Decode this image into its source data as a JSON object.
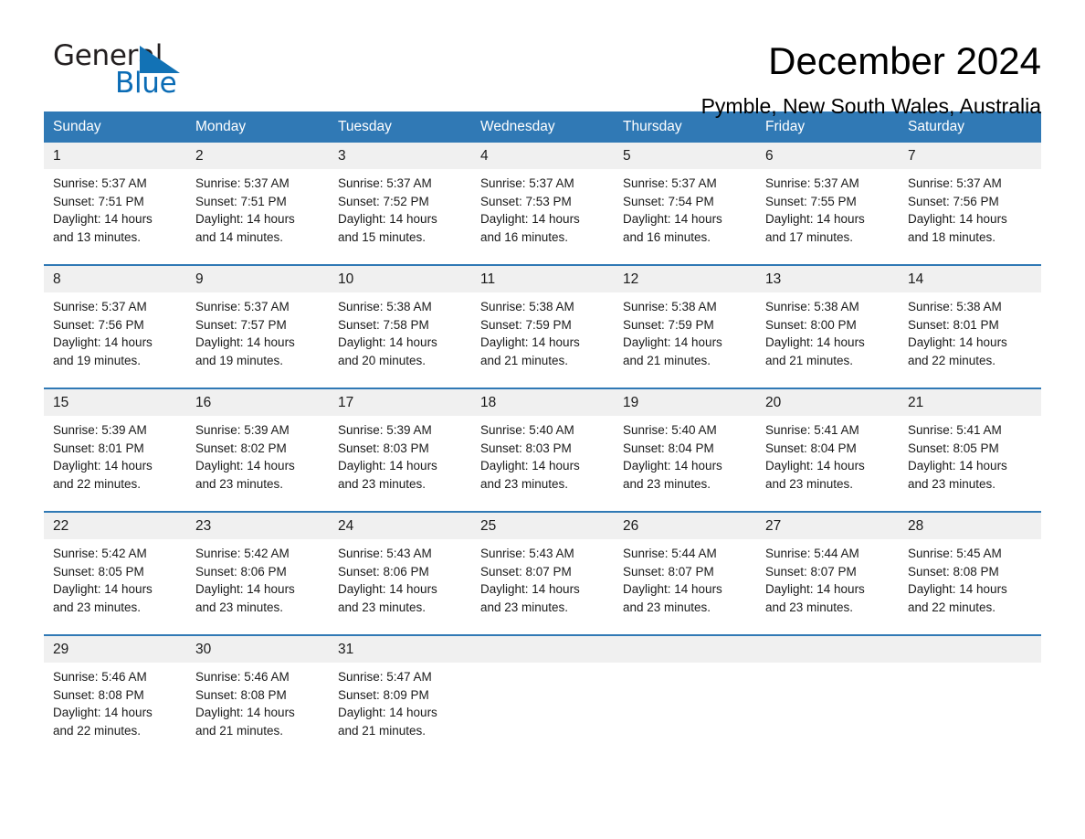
{
  "brand": {
    "name_part1": "General",
    "name_part2": "Blue",
    "triangle_icon": "brand-triangle-icon",
    "color_black": "#231f20",
    "color_blue": "#0b6cb5"
  },
  "header": {
    "title": "December 2024",
    "location": "Pymble, New South Wales, Australia"
  },
  "theme": {
    "header_blue": "#3079b5",
    "row_rule_blue": "#3079b5",
    "daynum_background": "#f0f0f0",
    "page_background": "#ffffff"
  },
  "calendar": {
    "weekday_headers": [
      "Sunday",
      "Monday",
      "Tuesday",
      "Wednesday",
      "Thursday",
      "Friday",
      "Saturday"
    ],
    "weeks": [
      [
        {
          "day": "1",
          "sunrise": "Sunrise: 5:37 AM",
          "sunset": "Sunset: 7:51 PM",
          "daylight_line1": "Daylight: 14 hours",
          "daylight_line2": "and 13 minutes."
        },
        {
          "day": "2",
          "sunrise": "Sunrise: 5:37 AM",
          "sunset": "Sunset: 7:51 PM",
          "daylight_line1": "Daylight: 14 hours",
          "daylight_line2": "and 14 minutes."
        },
        {
          "day": "3",
          "sunrise": "Sunrise: 5:37 AM",
          "sunset": "Sunset: 7:52 PM",
          "daylight_line1": "Daylight: 14 hours",
          "daylight_line2": "and 15 minutes."
        },
        {
          "day": "4",
          "sunrise": "Sunrise: 5:37 AM",
          "sunset": "Sunset: 7:53 PM",
          "daylight_line1": "Daylight: 14 hours",
          "daylight_line2": "and 16 minutes."
        },
        {
          "day": "5",
          "sunrise": "Sunrise: 5:37 AM",
          "sunset": "Sunset: 7:54 PM",
          "daylight_line1": "Daylight: 14 hours",
          "daylight_line2": "and 16 minutes."
        },
        {
          "day": "6",
          "sunrise": "Sunrise: 5:37 AM",
          "sunset": "Sunset: 7:55 PM",
          "daylight_line1": "Daylight: 14 hours",
          "daylight_line2": "and 17 minutes."
        },
        {
          "day": "7",
          "sunrise": "Sunrise: 5:37 AM",
          "sunset": "Sunset: 7:56 PM",
          "daylight_line1": "Daylight: 14 hours",
          "daylight_line2": "and 18 minutes."
        }
      ],
      [
        {
          "day": "8",
          "sunrise": "Sunrise: 5:37 AM",
          "sunset": "Sunset: 7:56 PM",
          "daylight_line1": "Daylight: 14 hours",
          "daylight_line2": "and 19 minutes."
        },
        {
          "day": "9",
          "sunrise": "Sunrise: 5:37 AM",
          "sunset": "Sunset: 7:57 PM",
          "daylight_line1": "Daylight: 14 hours",
          "daylight_line2": "and 19 minutes."
        },
        {
          "day": "10",
          "sunrise": "Sunrise: 5:38 AM",
          "sunset": "Sunset: 7:58 PM",
          "daylight_line1": "Daylight: 14 hours",
          "daylight_line2": "and 20 minutes."
        },
        {
          "day": "11",
          "sunrise": "Sunrise: 5:38 AM",
          "sunset": "Sunset: 7:59 PM",
          "daylight_line1": "Daylight: 14 hours",
          "daylight_line2": "and 21 minutes."
        },
        {
          "day": "12",
          "sunrise": "Sunrise: 5:38 AM",
          "sunset": "Sunset: 7:59 PM",
          "daylight_line1": "Daylight: 14 hours",
          "daylight_line2": "and 21 minutes."
        },
        {
          "day": "13",
          "sunrise": "Sunrise: 5:38 AM",
          "sunset": "Sunset: 8:00 PM",
          "daylight_line1": "Daylight: 14 hours",
          "daylight_line2": "and 21 minutes."
        },
        {
          "day": "14",
          "sunrise": "Sunrise: 5:38 AM",
          "sunset": "Sunset: 8:01 PM",
          "daylight_line1": "Daylight: 14 hours",
          "daylight_line2": "and 22 minutes."
        }
      ],
      [
        {
          "day": "15",
          "sunrise": "Sunrise: 5:39 AM",
          "sunset": "Sunset: 8:01 PM",
          "daylight_line1": "Daylight: 14 hours",
          "daylight_line2": "and 22 minutes."
        },
        {
          "day": "16",
          "sunrise": "Sunrise: 5:39 AM",
          "sunset": "Sunset: 8:02 PM",
          "daylight_line1": "Daylight: 14 hours",
          "daylight_line2": "and 23 minutes."
        },
        {
          "day": "17",
          "sunrise": "Sunrise: 5:39 AM",
          "sunset": "Sunset: 8:03 PM",
          "daylight_line1": "Daylight: 14 hours",
          "daylight_line2": "and 23 minutes."
        },
        {
          "day": "18",
          "sunrise": "Sunrise: 5:40 AM",
          "sunset": "Sunset: 8:03 PM",
          "daylight_line1": "Daylight: 14 hours",
          "daylight_line2": "and 23 minutes."
        },
        {
          "day": "19",
          "sunrise": "Sunrise: 5:40 AM",
          "sunset": "Sunset: 8:04 PM",
          "daylight_line1": "Daylight: 14 hours",
          "daylight_line2": "and 23 minutes."
        },
        {
          "day": "20",
          "sunrise": "Sunrise: 5:41 AM",
          "sunset": "Sunset: 8:04 PM",
          "daylight_line1": "Daylight: 14 hours",
          "daylight_line2": "and 23 minutes."
        },
        {
          "day": "21",
          "sunrise": "Sunrise: 5:41 AM",
          "sunset": "Sunset: 8:05 PM",
          "daylight_line1": "Daylight: 14 hours",
          "daylight_line2": "and 23 minutes."
        }
      ],
      [
        {
          "day": "22",
          "sunrise": "Sunrise: 5:42 AM",
          "sunset": "Sunset: 8:05 PM",
          "daylight_line1": "Daylight: 14 hours",
          "daylight_line2": "and 23 minutes."
        },
        {
          "day": "23",
          "sunrise": "Sunrise: 5:42 AM",
          "sunset": "Sunset: 8:06 PM",
          "daylight_line1": "Daylight: 14 hours",
          "daylight_line2": "and 23 minutes."
        },
        {
          "day": "24",
          "sunrise": "Sunrise: 5:43 AM",
          "sunset": "Sunset: 8:06 PM",
          "daylight_line1": "Daylight: 14 hours",
          "daylight_line2": "and 23 minutes."
        },
        {
          "day": "25",
          "sunrise": "Sunrise: 5:43 AM",
          "sunset": "Sunset: 8:07 PM",
          "daylight_line1": "Daylight: 14 hours",
          "daylight_line2": "and 23 minutes."
        },
        {
          "day": "26",
          "sunrise": "Sunrise: 5:44 AM",
          "sunset": "Sunset: 8:07 PM",
          "daylight_line1": "Daylight: 14 hours",
          "daylight_line2": "and 23 minutes."
        },
        {
          "day": "27",
          "sunrise": "Sunrise: 5:44 AM",
          "sunset": "Sunset: 8:07 PM",
          "daylight_line1": "Daylight: 14 hours",
          "daylight_line2": "and 23 minutes."
        },
        {
          "day": "28",
          "sunrise": "Sunrise: 5:45 AM",
          "sunset": "Sunset: 8:08 PM",
          "daylight_line1": "Daylight: 14 hours",
          "daylight_line2": "and 22 minutes."
        }
      ],
      [
        {
          "day": "29",
          "sunrise": "Sunrise: 5:46 AM",
          "sunset": "Sunset: 8:08 PM",
          "daylight_line1": "Daylight: 14 hours",
          "daylight_line2": "and 22 minutes."
        },
        {
          "day": "30",
          "sunrise": "Sunrise: 5:46 AM",
          "sunset": "Sunset: 8:08 PM",
          "daylight_line1": "Daylight: 14 hours",
          "daylight_line2": "and 21 minutes."
        },
        {
          "day": "31",
          "sunrise": "Sunrise: 5:47 AM",
          "sunset": "Sunset: 8:09 PM",
          "daylight_line1": "Daylight: 14 hours",
          "daylight_line2": "and 21 minutes."
        },
        {
          "day": "",
          "sunrise": "",
          "sunset": "",
          "daylight_line1": "",
          "daylight_line2": ""
        },
        {
          "day": "",
          "sunrise": "",
          "sunset": "",
          "daylight_line1": "",
          "daylight_line2": ""
        },
        {
          "day": "",
          "sunrise": "",
          "sunset": "",
          "daylight_line1": "",
          "daylight_line2": ""
        },
        {
          "day": "",
          "sunrise": "",
          "sunset": "",
          "daylight_line1": "",
          "daylight_line2": ""
        }
      ]
    ]
  }
}
